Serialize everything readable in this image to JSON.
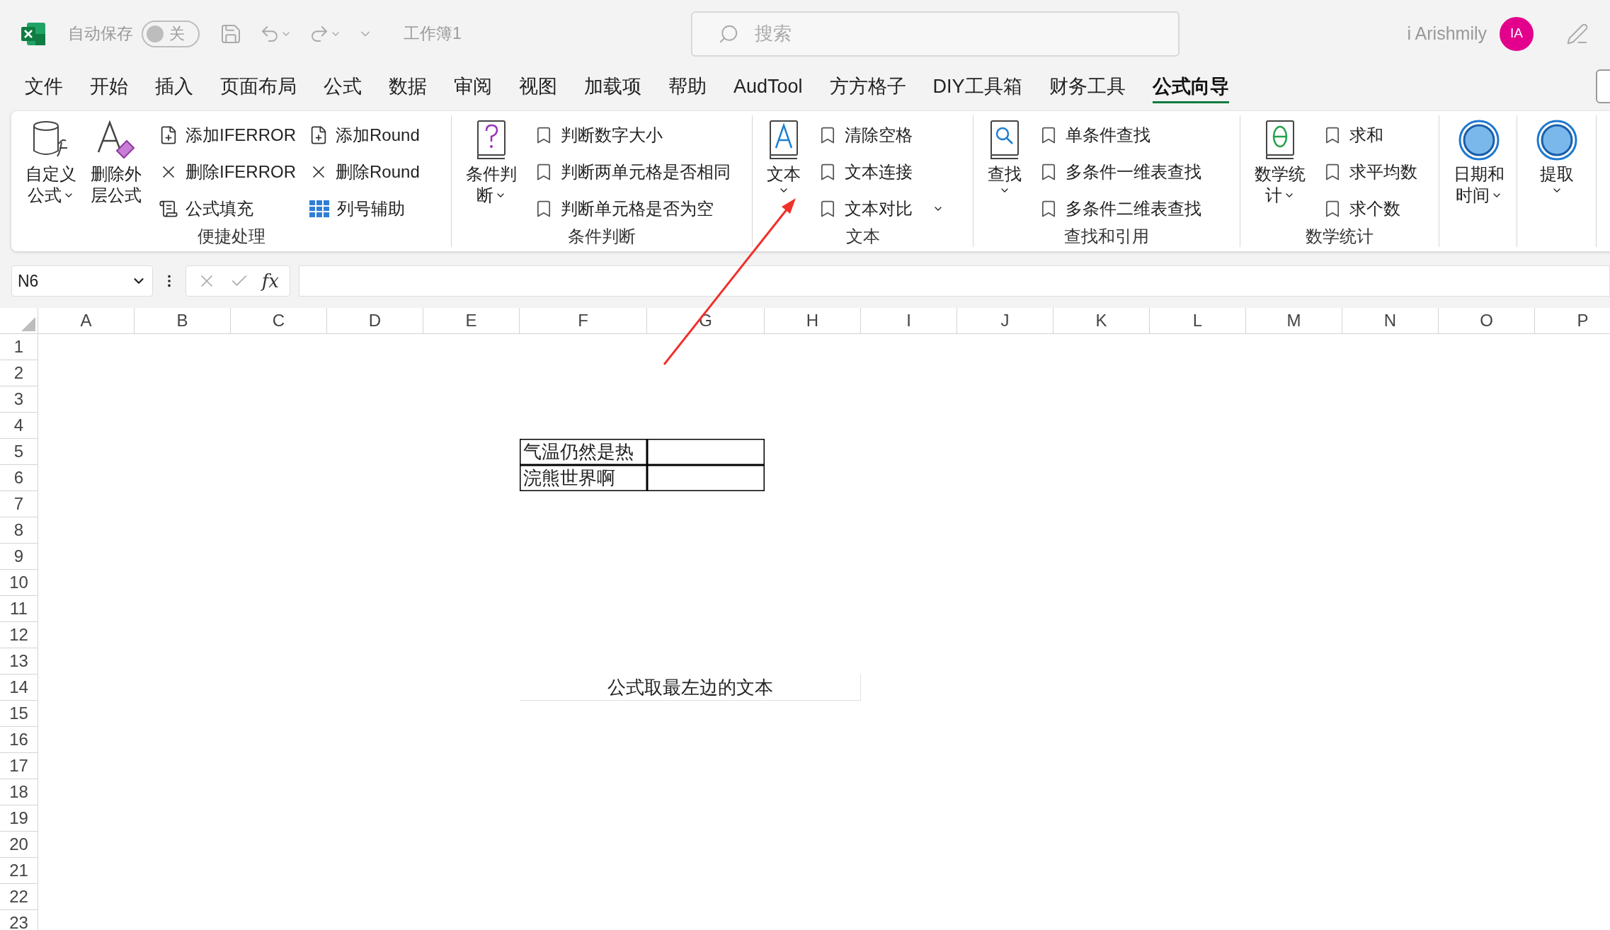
{
  "title_bar": {
    "autosave_label": "自动保存",
    "autosave": {
      "on": false,
      "state_label": "关"
    },
    "workbook_name": "工作簿1",
    "search": {
      "placeholder": "搜索"
    },
    "user_name": "i Arishmily",
    "avatar_initials": "IA"
  },
  "ribbon_tabs": [
    {
      "label": "文件",
      "selected": false
    },
    {
      "label": "开始",
      "selected": false
    },
    {
      "label": "插入",
      "selected": false
    },
    {
      "label": "页面布局",
      "selected": false
    },
    {
      "label": "公式",
      "selected": false
    },
    {
      "label": "数据",
      "selected": false
    },
    {
      "label": "审阅",
      "selected": false
    },
    {
      "label": "视图",
      "selected": false
    },
    {
      "label": "加载项",
      "selected": false
    },
    {
      "label": "帮助",
      "selected": false
    },
    {
      "label": "AudTool",
      "selected": false
    },
    {
      "label": "方方格子",
      "selected": false
    },
    {
      "label": "DIY工具箱",
      "selected": false
    },
    {
      "label": "财务工具",
      "selected": false
    },
    {
      "label": "公式向导",
      "selected": true
    }
  ],
  "ribbon_groups": [
    {
      "label": "便捷处理",
      "large_buttons": [
        {
          "lines": [
            "自定义",
            "公式"
          ],
          "has_menu": true
        },
        {
          "lines": [
            "删除外",
            "层公式"
          ],
          "has_menu": false
        }
      ],
      "columns": [
        [
          {
            "label": "添加IFERROR",
            "has_menu": false
          },
          {
            "label": "删除IFERROR",
            "has_menu": false
          },
          {
            "label": "公式填充",
            "has_menu": false
          }
        ],
        [
          {
            "label": "添加Round",
            "has_menu": false
          },
          {
            "label": "删除Round",
            "has_menu": false
          },
          {
            "label": "列号辅助",
            "has_menu": false
          }
        ]
      ]
    },
    {
      "label": "条件判断",
      "large_buttons": [
        {
          "lines": [
            "条件判",
            "断"
          ],
          "has_menu": true
        }
      ],
      "columns": [
        [
          {
            "label": "判断数字大小",
            "has_menu": false
          },
          {
            "label": "判断两单元格是否相同",
            "has_menu": false
          },
          {
            "label": "判断单元格是否为空",
            "has_menu": false
          }
        ]
      ]
    },
    {
      "label": "文本",
      "large_buttons": [
        {
          "lines": [
            "文本"
          ],
          "has_menu": true
        }
      ],
      "columns": [
        [
          {
            "label": "清除空格",
            "has_menu": false
          },
          {
            "label": "文本连接",
            "has_menu": false
          },
          {
            "label": "文本对比",
            "has_menu": true
          }
        ]
      ]
    },
    {
      "label": "查找和引用",
      "large_buttons": [
        {
          "lines": [
            "查找"
          ],
          "has_menu": true
        }
      ],
      "columns": [
        [
          {
            "label": "单条件查找",
            "has_menu": false
          },
          {
            "label": "多条件一维表查找",
            "has_menu": false
          },
          {
            "label": "多条件二维表查找",
            "has_menu": false
          }
        ]
      ]
    },
    {
      "label": "数学统计",
      "large_buttons": [
        {
          "lines": [
            "数学统",
            "计"
          ],
          "has_menu": true
        }
      ],
      "columns": [
        [
          {
            "label": "求和",
            "has_menu": false
          },
          {
            "label": "求平均数",
            "has_menu": false
          },
          {
            "label": "求个数",
            "has_menu": false
          }
        ]
      ]
    },
    {
      "large_buttons": [
        {
          "lines": [
            "日期和",
            "时间"
          ],
          "has_menu": true
        }
      ]
    },
    {
      "large_buttons": [
        {
          "lines": [
            "提取"
          ],
          "has_menu": true
        }
      ]
    }
  ],
  "formula_bar": {
    "name_box": "N6",
    "function_symbol": "fx"
  },
  "sheet": {
    "columns": [
      "A",
      "B",
      "C",
      "D",
      "E",
      "F",
      "G",
      "H",
      "I",
      "J",
      "K",
      "L",
      "M",
      "N",
      "O",
      "P"
    ],
    "bordered_block": [
      {
        "text": "气温仍然是热"
      },
      {
        "text": "浣熊世界啊"
      }
    ],
    "merged_note": {
      "text": "公式取最左边的文本"
    },
    "rows": [
      {
        "label": "1"
      },
      {
        "label": "2"
      },
      {
        "label": "3"
      },
      {
        "label": "4"
      },
      {
        "label": "5"
      },
      {
        "label": "6"
      },
      {
        "label": "7"
      },
      {
        "label": "8"
      },
      {
        "label": "9"
      },
      {
        "label": "10"
      },
      {
        "label": "11"
      },
      {
        "label": "12"
      },
      {
        "label": "13"
      },
      {
        "label": "14"
      },
      {
        "label": "15"
      },
      {
        "label": "16"
      },
      {
        "label": "17"
      },
      {
        "label": "18"
      },
      {
        "label": "19"
      },
      {
        "label": "20"
      },
      {
        "label": "21"
      },
      {
        "label": "22"
      },
      {
        "label": "23"
      }
    ]
  }
}
